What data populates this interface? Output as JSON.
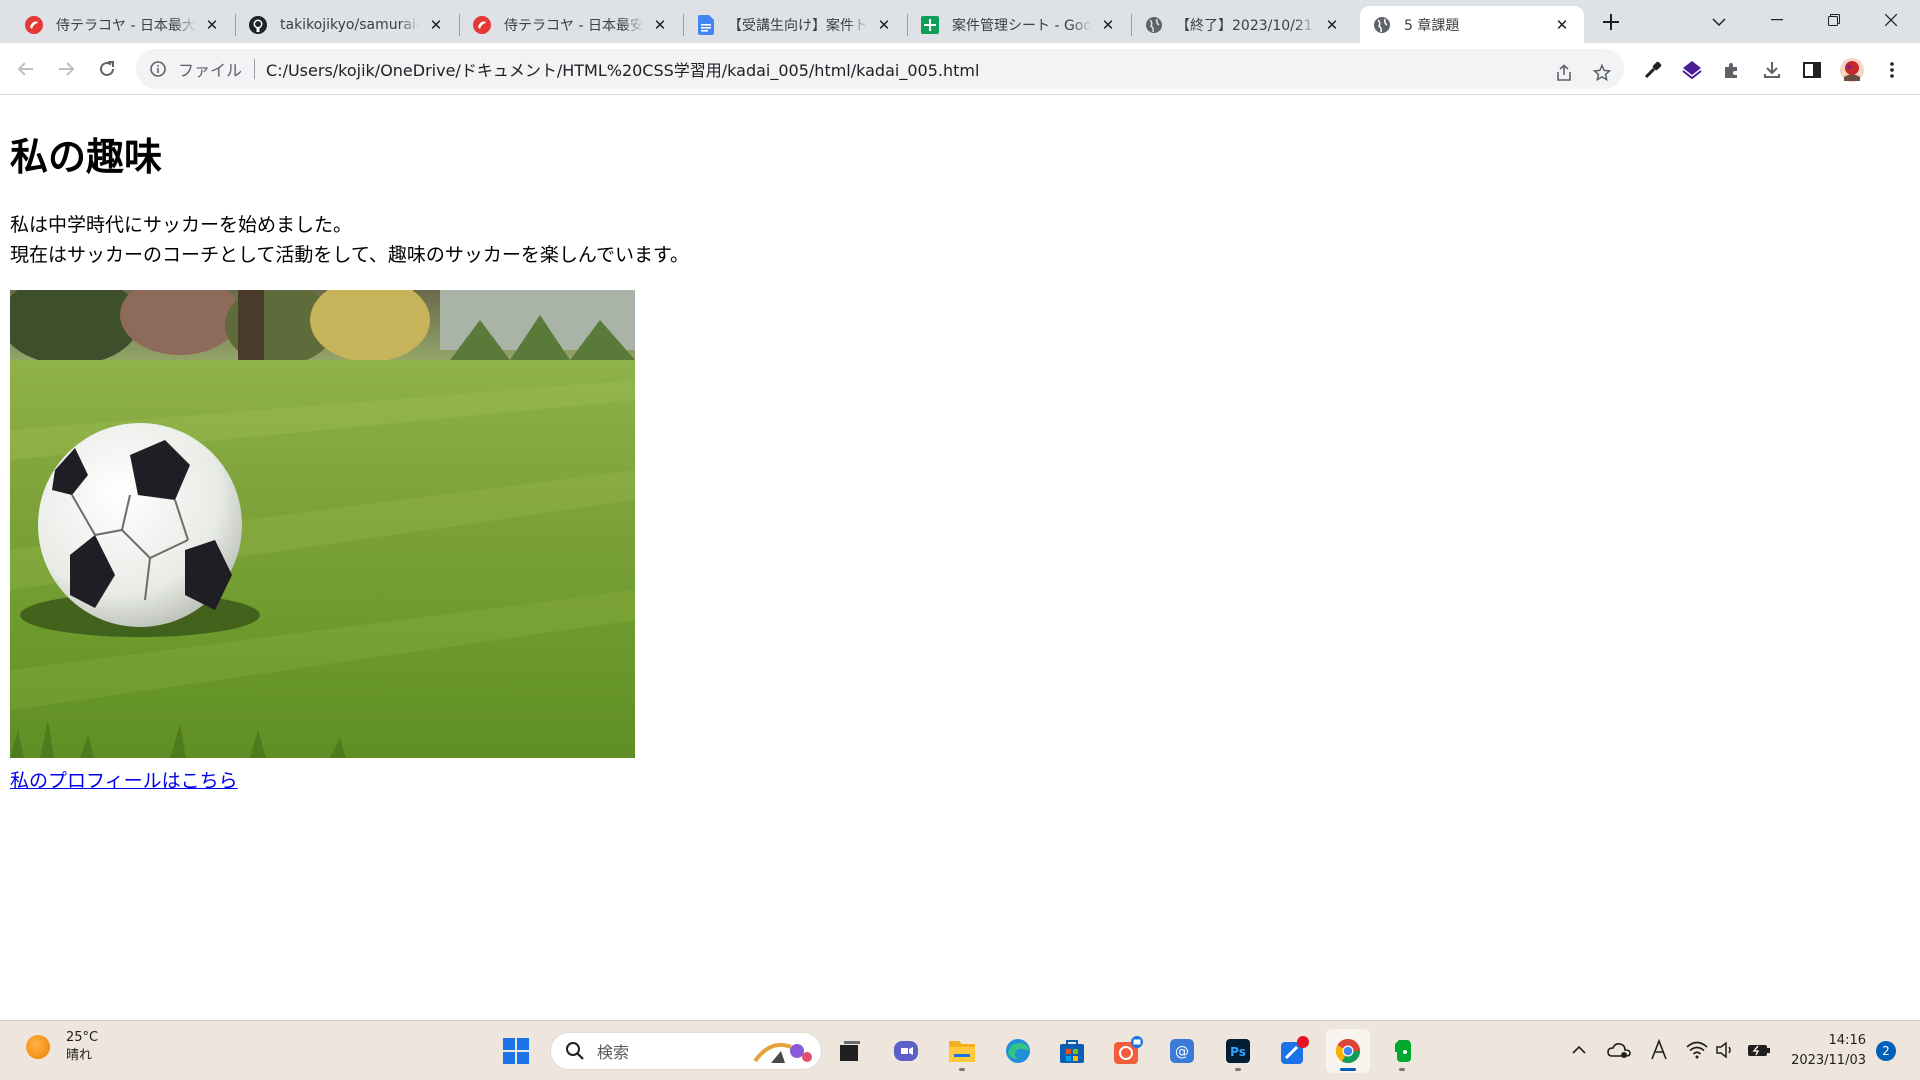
{
  "browser": {
    "tabs": [
      {
        "title": "侍テラコヤ - 日本最大級",
        "favicon": "samurai-icon",
        "active": false
      },
      {
        "title": "takikojikyo/samurai-t",
        "favicon": "github-icon",
        "active": false
      },
      {
        "title": "侍テラコヤ - 日本最安",
        "favicon": "samurai-icon",
        "active": false
      },
      {
        "title": "【受講生向け】案件トラ",
        "favicon": "google-docs-icon",
        "active": false
      },
      {
        "title": "案件管理シート - Goog",
        "favicon": "google-sheets-icon",
        "active": false
      },
      {
        "title": "【終了】2023/10/21",
        "favicon": "globe-icon",
        "active": false
      },
      {
        "title": "5 章課題",
        "favicon": "globe-icon",
        "active": true
      }
    ],
    "address": {
      "scheme_label": "ファイル",
      "url": "C:/Users/kojik/OneDrive/ドキュメント/HTML%20CSS学習用/kadai_005/html/kadai_005.html"
    }
  },
  "page": {
    "heading": "私の趣味",
    "paragraph_line1": "私は中学時代にサッカーを始めました。",
    "paragraph_line2": "現在はサッカーのコーチとして活動をして、趣味のサッカーを楽しんでいます。",
    "link_text": "私のプロフィールはこちら"
  },
  "taskbar": {
    "weather_temp": "25°C",
    "weather_desc": "晴れ",
    "search_placeholder": "検索",
    "time": "14:16",
    "date": "2023/11/03",
    "notification_count": "2"
  },
  "colors": {
    "tabstrip": "#dee1e6",
    "link": "#0000ee",
    "taskbar": "#eee6dc",
    "accent": "#005fb8"
  }
}
